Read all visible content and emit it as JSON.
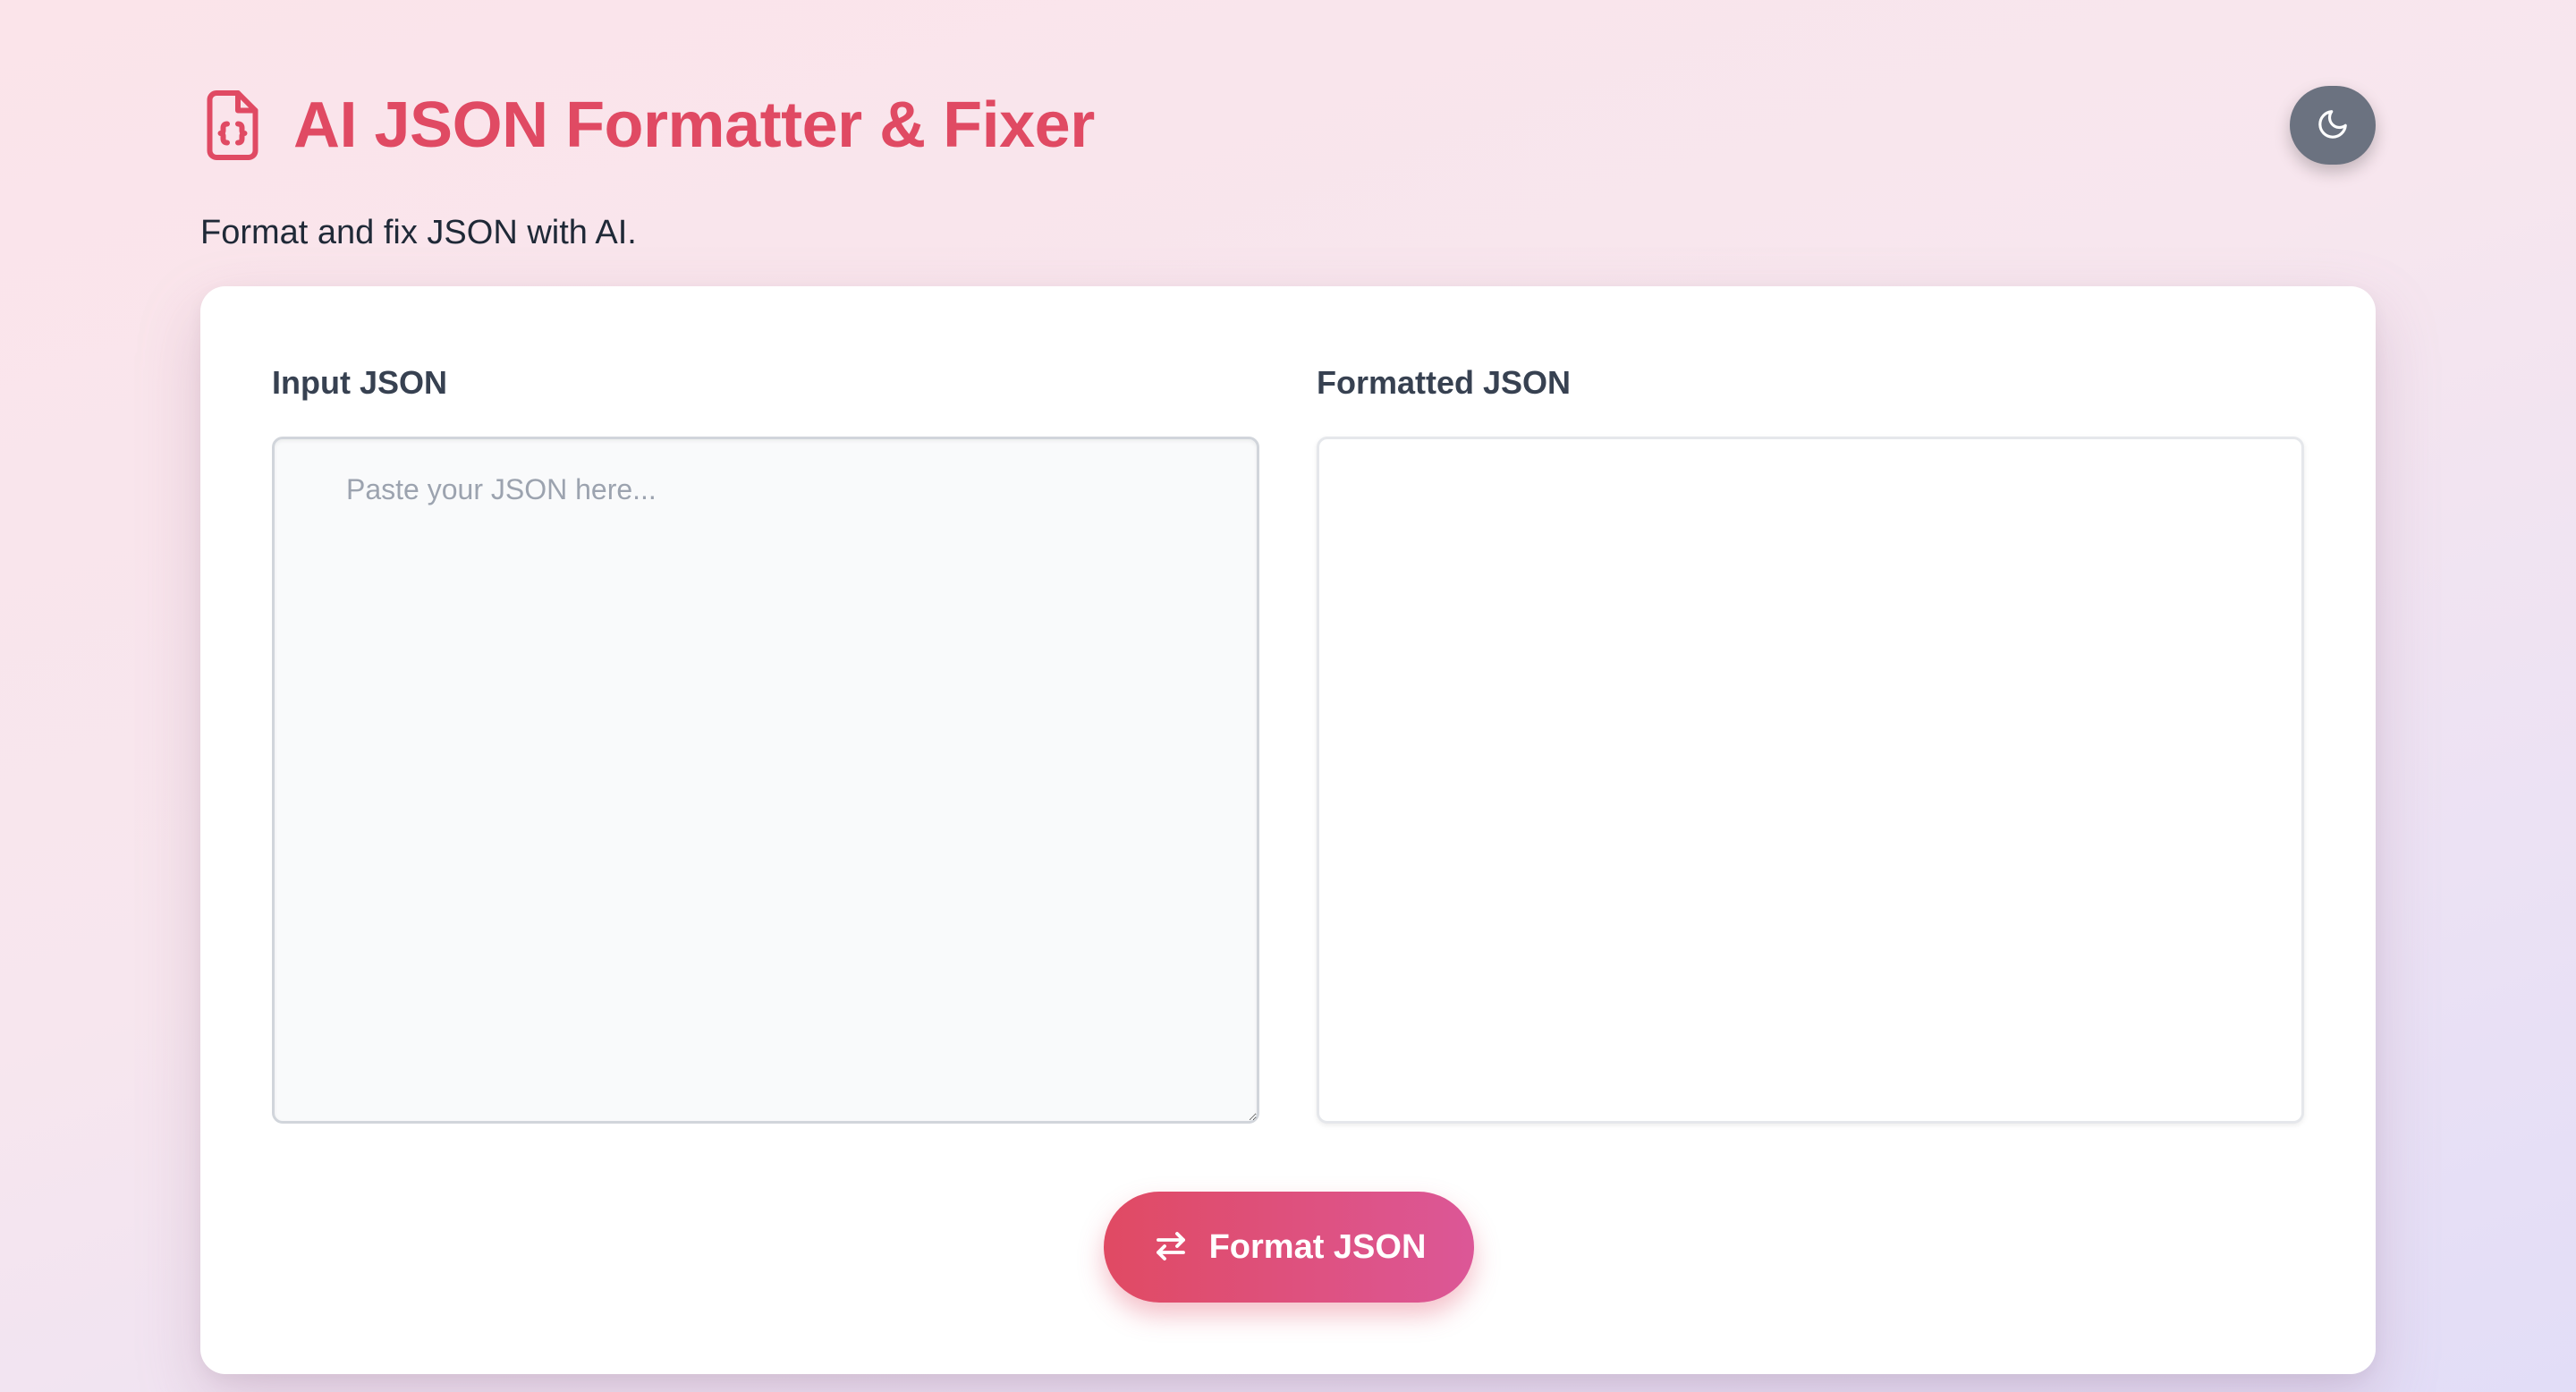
{
  "app": {
    "title": "AI JSON Formatter & Fixer",
    "subtitle": "Format and fix JSON with AI.",
    "title_icon": "file-code-icon",
    "accent_color": "#e04a63",
    "accent_gradient_end": "#dc5797"
  },
  "theme_toggle": {
    "icon": "moon-icon",
    "background": "#6b7280"
  },
  "input_panel": {
    "label": "Input JSON",
    "value": "",
    "placeholder": "Paste your JSON here..."
  },
  "output_panel": {
    "label": "Formatted JSON",
    "value": ""
  },
  "format_button": {
    "label": "Format JSON",
    "icon": "swap-arrows-icon"
  }
}
